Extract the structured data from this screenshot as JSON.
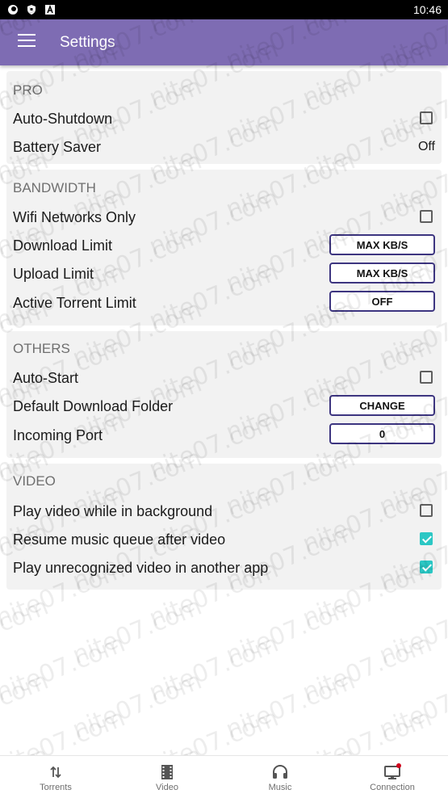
{
  "status_bar": {
    "time": "10:46",
    "icons": [
      "app-notification-icon",
      "shield-icon",
      "letter-a-icon"
    ]
  },
  "app_bar": {
    "title": "Settings",
    "menu_icon": "hamburger-menu-icon"
  },
  "sections": {
    "pro": {
      "title": "PRO",
      "auto_shutdown": {
        "label": "Auto-Shutdown",
        "checked": false
      },
      "battery_saver": {
        "label": "Battery Saver",
        "value": "Off"
      }
    },
    "bandwidth": {
      "title": "BANDWIDTH",
      "wifi_only": {
        "label": "Wifi Networks Only",
        "checked": false
      },
      "download_limit": {
        "label": "Download Limit",
        "button": "MAX KB/S"
      },
      "upload_limit": {
        "label": "Upload Limit",
        "button": "MAX KB/S"
      },
      "active_torrent_limit": {
        "label": "Active Torrent Limit",
        "button": "OFF"
      }
    },
    "others": {
      "title": "OTHERS",
      "auto_start": {
        "label": "Auto-Start",
        "checked": false
      },
      "download_folder": {
        "label": "Default Download Folder",
        "button": "CHANGE"
      },
      "incoming_port": {
        "label": "Incoming Port",
        "button": "0"
      }
    },
    "video": {
      "title": "VIDEO",
      "background_play": {
        "label": "Play video while in background",
        "checked": false
      },
      "resume_music": {
        "label": "Resume music queue after video",
        "checked": true
      },
      "unrecognized_video": {
        "label": "Play unrecognized video in another app",
        "checked": true
      }
    }
  },
  "bottom_nav": [
    {
      "label": "Torrents",
      "icon": "torrents-arrows-icon"
    },
    {
      "label": "Video",
      "icon": "film-strip-icon"
    },
    {
      "label": "Music",
      "icon": "headphones-icon"
    },
    {
      "label": "Connection",
      "icon": "monitor-icon",
      "badge": true
    }
  ],
  "colors": {
    "app_bar": "#7e6cb3",
    "accent_check": "#2bc7c4",
    "button_border": "#3d3580",
    "section_bg": "#f2f2f2",
    "badge": "#d0021b"
  },
  "watermark": "nite07.com"
}
